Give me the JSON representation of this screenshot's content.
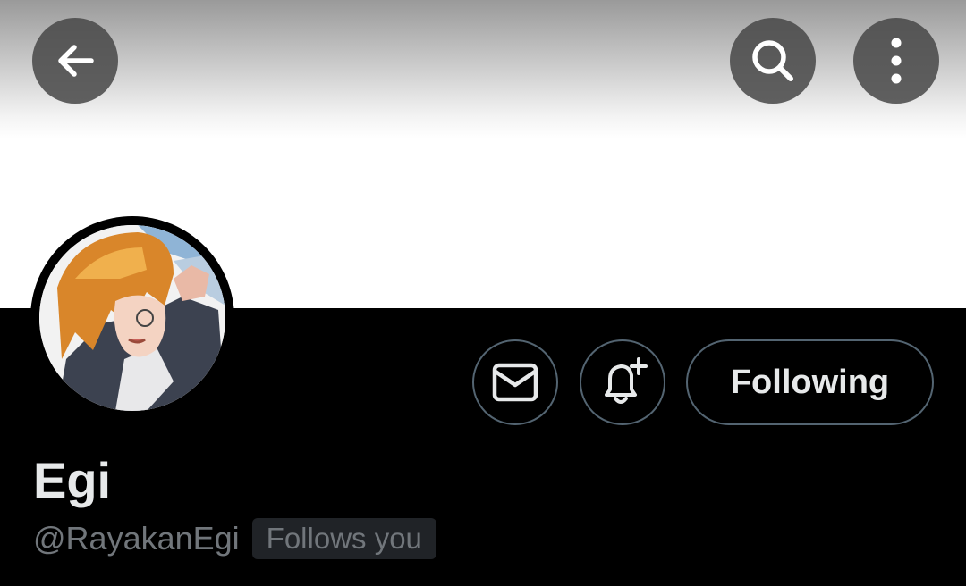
{
  "header": {
    "back_icon": "arrow-left-icon",
    "search_icon": "search-icon",
    "more_icon": "more-vertical-icon"
  },
  "profile": {
    "display_name": "Egi",
    "handle": "@RayakanEgi",
    "follows_you_label": "Follows you",
    "avatar_icon": "avatar-image"
  },
  "actions": {
    "message_icon": "envelope-icon",
    "notify_icon": "bell-plus-icon",
    "following_label": "Following"
  },
  "colors": {
    "background": "#000000",
    "text_primary": "#e7e9ea",
    "text_secondary": "#71767b",
    "button_border": "#536471",
    "badge_background": "#202327"
  }
}
